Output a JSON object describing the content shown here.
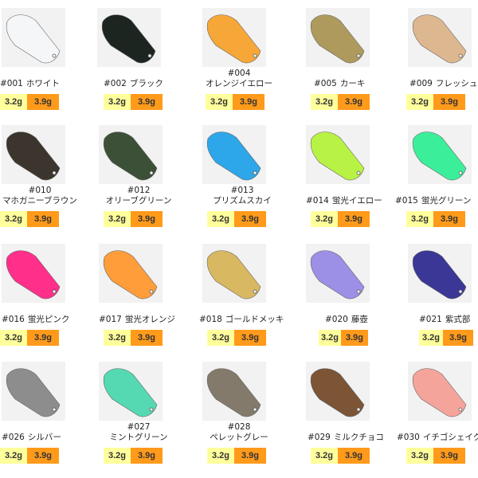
{
  "items": [
    {
      "code": "#001",
      "name": "ホワイト",
      "color": "#f4f6f8",
      "w1": "3.2g",
      "w2": "3.9g"
    },
    {
      "code": "#002",
      "name": "ブラック",
      "color": "#1c2520",
      "w1": "3.2g",
      "w2": "3.9g"
    },
    {
      "code": "#004",
      "name": "オレンジイエロー",
      "color": "#f6a737",
      "w1": "3.2g",
      "w2": "3.9g"
    },
    {
      "code": "#005",
      "name": "カーキ",
      "color": "#ad9a5c",
      "w1": "3.2g",
      "w2": "3.9g"
    },
    {
      "code": "#009",
      "name": "フレッシュ",
      "color": "#ddb78f",
      "w1": "3.2g",
      "w2": "3.9g"
    },
    {
      "code": "#010",
      "name": "マホガニーブラウン",
      "color": "#3c352d",
      "w1": "3.2g",
      "w2": "3.9g"
    },
    {
      "code": "#012",
      "name": "オリーブグリーン",
      "color": "#3b5036",
      "w1": "3.2g",
      "w2": "3.9g"
    },
    {
      "code": "#013",
      "name": "プリズムスカイ",
      "color": "#2da6ea",
      "w1": "3.2g",
      "w2": "3.9g"
    },
    {
      "code": "#014",
      "name": "蛍光イエロー",
      "color": "#b8f245",
      "w1": "3.2g",
      "w2": "3.9g"
    },
    {
      "code": "#015",
      "name": "蛍光グリーン",
      "color": "#3bef9a",
      "w1": "3.2g",
      "w2": "3.9g"
    },
    {
      "code": "#016",
      "name": "蛍光ピンク",
      "color": "#ff2f8a",
      "w1": "3.2g",
      "w2": "3.9g"
    },
    {
      "code": "#017",
      "name": "蛍光オレンジ",
      "color": "#ff9d3b",
      "w1": "3.2g",
      "w2": "3.9g"
    },
    {
      "code": "#018",
      "name": "ゴールドメッキ",
      "color": "#d8b860",
      "w1": "3.2g",
      "w2": "3.9g"
    },
    {
      "code": "#020",
      "name": "藤壺",
      "color": "#9c8fe6",
      "w1": "3.2g",
      "w2": "3.9g"
    },
    {
      "code": "#021",
      "name": "紫式部",
      "color": "#3a3796",
      "w1": "3.2g",
      "w2": "3.9g"
    },
    {
      "code": "#026",
      "name": "シルバー",
      "color": "#8d8d8d",
      "w1": "3.2g",
      "w2": "3.9g"
    },
    {
      "code": "#027",
      "name": "ミントグリーン",
      "color": "#54d9b3",
      "w1": "3.2g",
      "w2": "3.9g"
    },
    {
      "code": "#028",
      "name": "ペレットグレー",
      "color": "#837a6c",
      "w1": "3.2g",
      "w2": "3.9g"
    },
    {
      "code": "#029",
      "name": "ミルクチョコ",
      "color": "#7c5436",
      "w1": "3.2g",
      "w2": "3.9g"
    },
    {
      "code": "#030",
      "name": "イチゴシェイク",
      "color": "#f5a49c",
      "w1": "3.2g",
      "w2": "3.9g"
    }
  ]
}
